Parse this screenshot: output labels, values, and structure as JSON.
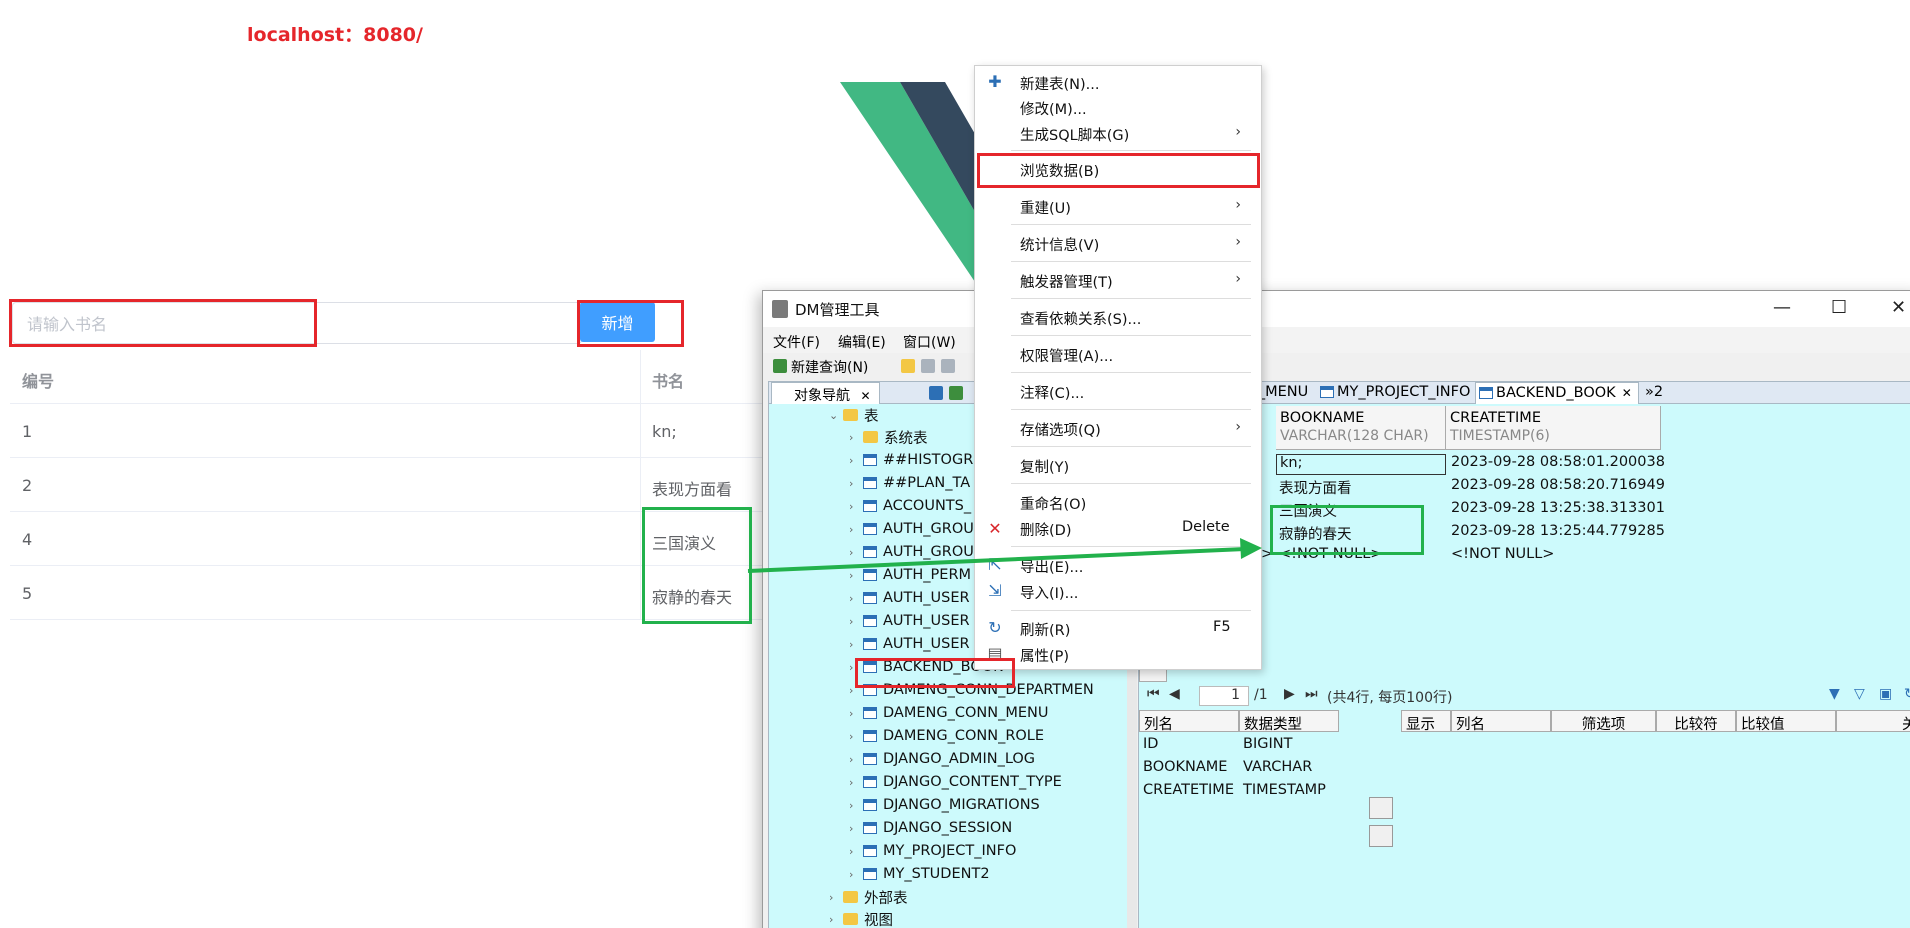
{
  "web": {
    "url": "localhost：8080/",
    "search_placeholder": "请输入书名",
    "add_button": "新增",
    "table": {
      "headers": [
        "编号",
        "书名"
      ],
      "rows": [
        {
          "id": "1",
          "name": "kn;"
        },
        {
          "id": "2",
          "name": "表现方面看"
        },
        {
          "id": "4",
          "name": "三国演义"
        },
        {
          "id": "5",
          "name": "寂静的春天"
        }
      ]
    }
  },
  "dm": {
    "title": "DM管理工具",
    "menu": [
      "文件(F)",
      "编辑(E)",
      "窗口(W)"
    ],
    "toolbar_new_query": "新建查询(N)",
    "nav_tab": "对象导航",
    "tree": {
      "tables_folder": "表",
      "system_tables": "系统表",
      "items": [
        "##HISTOGR",
        "##PLAN_TA",
        "ACCOUNTS_",
        "AUTH_GROU",
        "AUTH_GROU",
        "AUTH_PERM",
        "AUTH_USER",
        "AUTH_USER",
        "AUTH_USER",
        "BACKEND_BOOK",
        "DAMENG_CONN_DEPARTMEN",
        "DAMENG_CONN_MENU",
        "DAMENG_CONN_ROLE",
        "DJANGO_ADMIN_LOG",
        "DJANGO_CONTENT_TYPE",
        "DJANGO_MIGRATIONS",
        "DJANGO_SESSION",
        "MY_PROJECT_INFO",
        "MY_STUDENT2"
      ],
      "external_tables": "外部表",
      "views": "视图"
    },
    "editor_tabs": [
      "N_MENU",
      "MY_PROJECT_INFO",
      "BACKEND_BOOK",
      "»2"
    ],
    "grid": {
      "columns": [
        {
          "name": "BOOKNAME",
          "type": "VARCHAR(128 CHAR)"
        },
        {
          "name": "CREATETIME",
          "type": "TIMESTAMP(6)"
        }
      ],
      "rows": [
        {
          "bookname": "kn;",
          "createtime": "2023-09-28 08:58:01.200038"
        },
        {
          "bookname": "表现方面看",
          "createtime": "2023-09-28 08:58:20.716949"
        },
        {
          "bookname": "三国演义",
          "createtime": "2023-09-28 13:25:38.313301"
        },
        {
          "bookname": "寂静的春天",
          "createtime": "2023-09-28 13:25:44.779285"
        },
        {
          "bookname": "<!NOT NULL>",
          "createtime": "<!NOT NULL>"
        }
      ],
      "row_marker": ">"
    },
    "pager": {
      "page": "1",
      "total": "/1",
      "summary": "(共4行, 每页100行)"
    },
    "col_panel": {
      "headers": [
        "列名",
        "数据类型"
      ],
      "rows": [
        {
          "name": "ID",
          "type": "BIGINT"
        },
        {
          "name": "BOOKNAME",
          "type": "VARCHAR"
        },
        {
          "name": "CREATETIME",
          "type": "TIMESTAMP"
        }
      ]
    },
    "filter_panel": {
      "headers": [
        "显示",
        "列名",
        "筛选项",
        "比较符",
        "比较值",
        "关系"
      ]
    }
  },
  "context_menu": {
    "items": [
      {
        "label": "新建表(N)...",
        "icon": "plus-icon"
      },
      {
        "label": "修改(M)..."
      },
      {
        "label": "生成SQL脚本(G)",
        "submenu": true
      },
      {
        "label": "浏览数据(B)"
      },
      {
        "label": "重建(U)",
        "submenu": true
      },
      {
        "label": "统计信息(V)",
        "submenu": true
      },
      {
        "label": "触发器管理(T)",
        "submenu": true
      },
      {
        "label": "查看依赖关系(S)..."
      },
      {
        "label": "权限管理(A)..."
      },
      {
        "label": "注释(C)..."
      },
      {
        "label": "存储选项(Q)",
        "submenu": true
      },
      {
        "label": "复制(Y)"
      },
      {
        "label": "重命名(O)"
      },
      {
        "label": "删除(D)",
        "shortcut": "Delete",
        "icon": "delete-icon"
      },
      {
        "label": "导出(E)...",
        "icon": "export-icon"
      },
      {
        "label": "导入(I)...",
        "icon": "import-icon"
      },
      {
        "label": "刷新(R)",
        "shortcut": "F5",
        "icon": "refresh-icon"
      },
      {
        "label": "属性(P)",
        "icon": "properties-icon"
      }
    ]
  },
  "colors": {
    "annotation_red": "#e5262b",
    "annotation_green": "#22b14c",
    "primary_button": "#409eff",
    "dm_panel_bg": "#cdfafc"
  }
}
